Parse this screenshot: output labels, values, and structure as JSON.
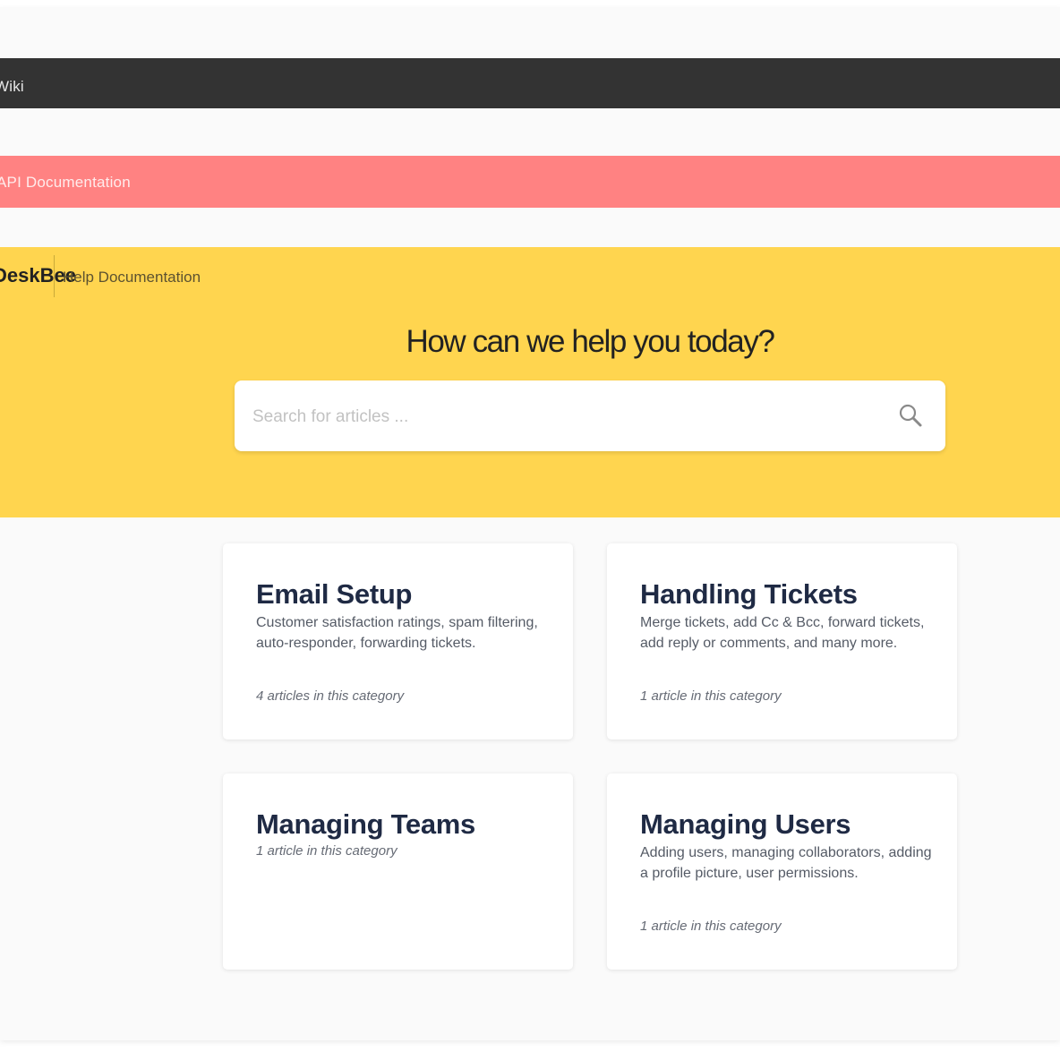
{
  "nav": {
    "wiki_label": "Wiki",
    "api_label": "API Documentation"
  },
  "header": {
    "brand": "DeskBee",
    "section": "Help Documentation"
  },
  "hero": {
    "title": "How can we help you today?",
    "search_placeholder": "Search for articles ...",
    "search_icon": "search-icon"
  },
  "colors": {
    "dark_bar": "#333333",
    "red_bar": "#ff8282",
    "hero_bg": "#ffd54f",
    "card_title": "#1f2a44"
  },
  "categories": [
    {
      "title": "Email Setup",
      "description": "Customer satisfaction ratings, spam filtering, auto-responder, forwarding tickets.",
      "count": "4 articles in this category"
    },
    {
      "title": "Handling Tickets",
      "description": "Merge tickets, add Cc & Bcc, forward tickets, add reply or comments, and many more.",
      "count": "1 article in this category"
    },
    {
      "title": "Managing Teams",
      "description": "",
      "count": "1 article in this category"
    },
    {
      "title": "Managing Users",
      "description": "Adding users, managing collaborators, adding a profile picture, user permissions.",
      "count": "1 article in this category"
    }
  ]
}
